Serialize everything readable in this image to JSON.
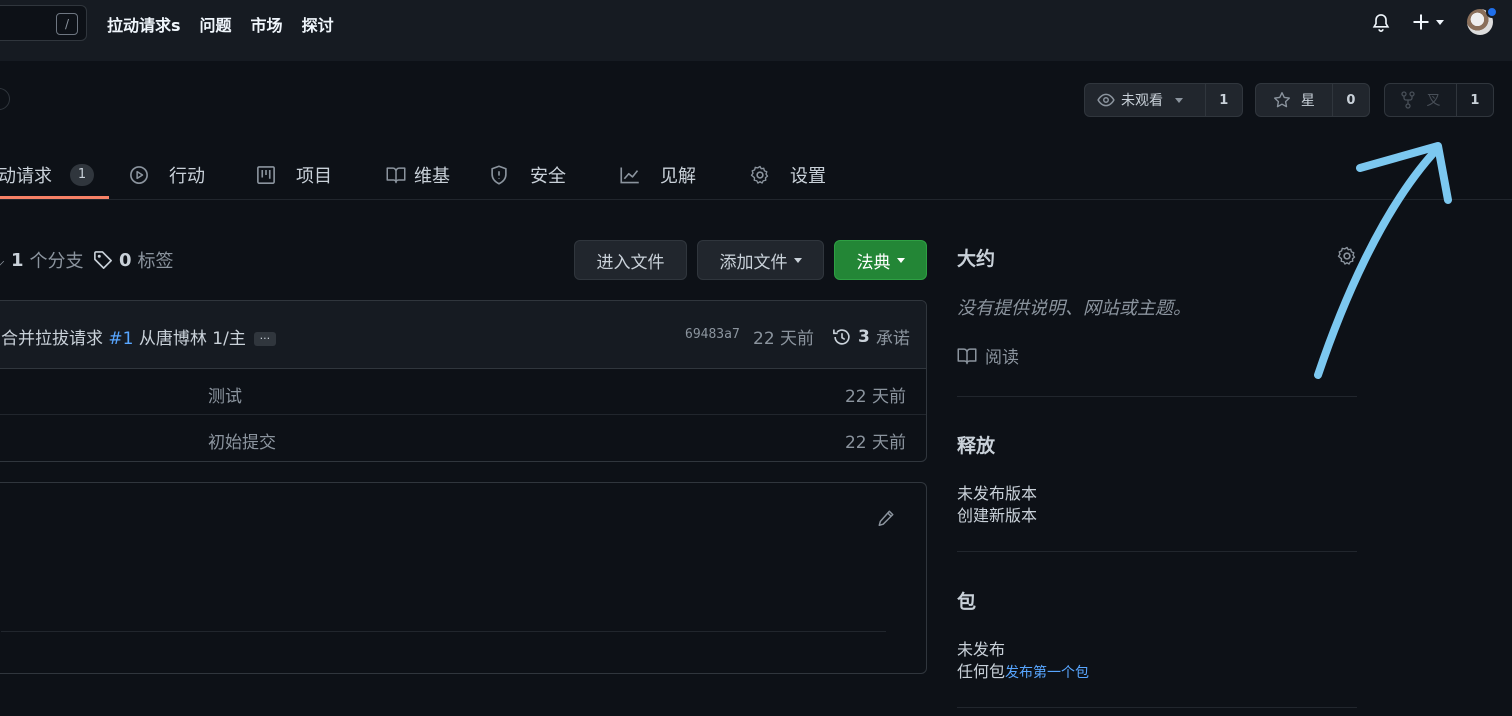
{
  "topbar": {
    "search_shortcut": "/",
    "nav": [
      "拉动请求s",
      "问题",
      "市场",
      "探讨"
    ]
  },
  "repo_actions": {
    "watch_label": "未观看",
    "watch_count": "1",
    "star_label": "星",
    "star_count": "0",
    "fork_label": "叉",
    "fork_count": "1"
  },
  "tabs": [
    {
      "label": "动请求",
      "counter": "1"
    },
    {
      "label": "行动"
    },
    {
      "label": "项目"
    },
    {
      "label": "维基"
    },
    {
      "label": "安全"
    },
    {
      "label": "见解"
    },
    {
      "label": "设置"
    }
  ],
  "meta": {
    "branch_count": "1",
    "branch_label": "个分支",
    "tag_count": "0",
    "tag_label": "标签"
  },
  "buttons": {
    "goto_file": "进入文件",
    "add_file": "添加文件",
    "code": "法典"
  },
  "commit": {
    "prefix": "合并拉拔请求 ",
    "pr_link": "#1",
    "suffix": " 从唐博林 1/主",
    "ellipsis": "...",
    "hash": "69483a7",
    "time": "22 天前",
    "count": "3",
    "count_label": "承诺"
  },
  "files": [
    {
      "message": "测试",
      "time": "22 天前"
    },
    {
      "message": "初始提交",
      "time": "22 天前"
    }
  ],
  "sidebar": {
    "about_title": "大约",
    "about_desc": "没有提供说明、网站或主题。",
    "readme_label": "阅读",
    "releases_title": "释放",
    "releases_none": "未发布版本",
    "releases_create": "创建新版本",
    "packages_title": "包",
    "packages_none": "未发布",
    "packages_prefix": "任何包",
    "packages_link": "发布第一个包"
  },
  "colors": {
    "background": "#0d1117",
    "header": "#161b22",
    "accent_green": "#238636",
    "link": "#58a6ff",
    "annotation_arrow": "#7cc8f0"
  }
}
